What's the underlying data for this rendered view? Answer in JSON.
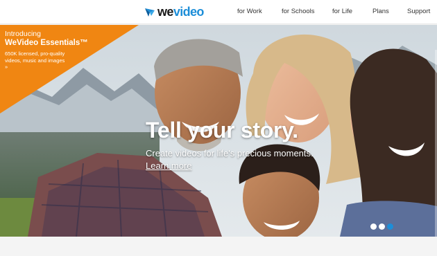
{
  "brand": {
    "logo_we": "we",
    "logo_video": "video",
    "accent_color": "#1d8ed8",
    "promo_color": "#f08612",
    "logo_icon": "play-arrow-icon"
  },
  "nav": {
    "items": [
      {
        "label": "for Work"
      },
      {
        "label": "for Schools"
      },
      {
        "label": "for Life"
      },
      {
        "label": "Plans"
      },
      {
        "label": "Support"
      }
    ]
  },
  "promo": {
    "intro": "Introducing",
    "title": "WeVideo Essentials™",
    "body": "650K licensed, pro-quality videos, music and images »"
  },
  "hero": {
    "headline": "Tell your story.",
    "subline": "Create videos for life's precious moments.",
    "link": "Learn more",
    "carousel": {
      "slide_count": 3,
      "active_slide": 3
    }
  }
}
